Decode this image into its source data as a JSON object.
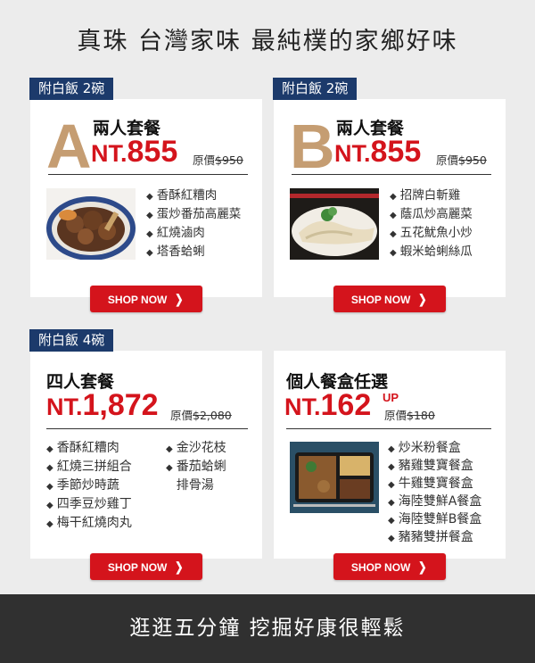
{
  "header": {
    "title": "真珠  台灣家味  最純樸的家鄉好味"
  },
  "cards": {
    "a": {
      "tag": "附白飯 2碗",
      "letter": "A",
      "name": "兩人套餐",
      "price_prefix": "NT.",
      "price": "855",
      "orig_label": "原價",
      "orig_price": "$950",
      "items": [
        "香酥紅糟肉",
        "蛋炒番茄高麗菜",
        "紅燒滷肉",
        "塔香蛤蜊"
      ],
      "button": "SHOP NOW"
    },
    "b": {
      "tag": "附白飯 2碗",
      "letter": "B",
      "name": "兩人套餐",
      "price_prefix": "NT.",
      "price": "855",
      "orig_label": "原價",
      "orig_price": "$950",
      "items": [
        "招牌白斬雞",
        "蔭瓜炒高麗菜",
        "五花魷魚小炒",
        "蝦米蛤蜊絲瓜"
      ],
      "button": "SHOP NOW"
    },
    "c": {
      "tag": "附白飯 4碗",
      "name": "四人套餐",
      "price_prefix": "NT.",
      "price": "1,872",
      "orig_label": "原價",
      "orig_price": "$2,080",
      "items_left": [
        "香酥紅糟肉",
        "紅燒三拼組合",
        "季節炒時蔬",
        "四季豆炒雞丁",
        "梅干紅燒肉丸"
      ],
      "items_right": [
        "金沙花枝",
        "番茄蛤蜊",
        "排骨湯"
      ],
      "button": "SHOP NOW"
    },
    "d": {
      "name": "個人餐盒任選",
      "price_prefix": "NT.",
      "price": "162",
      "up": "UP",
      "orig_label": "原價",
      "orig_price": "$180",
      "items": [
        "炒米粉餐盒",
        "豬雞雙寶餐盒",
        "牛雞雙寶餐盒",
        "海陸雙鮮A餐盒",
        "海陸雙鮮B餐盒",
        "豬豬雙拼餐盒"
      ],
      "button": "SHOP NOW"
    }
  },
  "footer": {
    "text": "逛逛五分鐘  挖掘好康很輕鬆"
  },
  "colors": {
    "accent_red": "#d4141c",
    "tag_navy": "#1c3a6b",
    "letter_gold": "#c59d72",
    "footer_bg": "#303030"
  },
  "icons": {
    "button_chevron": "chevron-right-icon",
    "bullet": "diamond-bullet-icon"
  }
}
